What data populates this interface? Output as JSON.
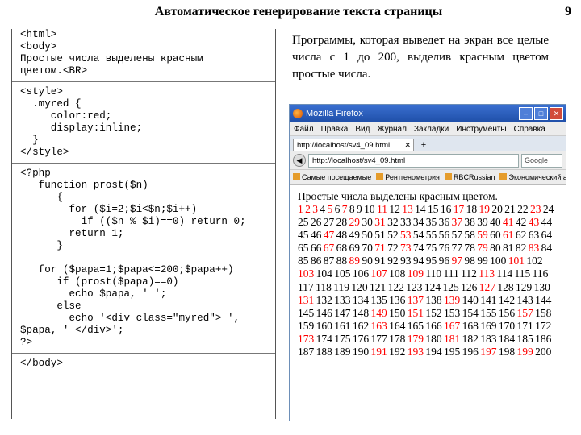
{
  "page": {
    "title": "Автоматическое генерирование текста страницы",
    "number": "9"
  },
  "code": {
    "html_block": [
      "<html>",
      "<body>",
      "Простые числа выделены красным",
      "цветом.<BR>"
    ],
    "style_block": [
      "<style>",
      "  .myred {",
      "     color:red;",
      "     display:inline;",
      "  }",
      "</style>"
    ],
    "php_block": [
      "<?php",
      "   function prost($n)",
      "      {",
      "        for ($i=2;$i<$n;$i++)",
      "          if (($n % $i)==0) return 0;",
      "        return 1;",
      "      }",
      "",
      "   for ($papa=1;$papa<=200;$papa++)",
      "      if (prost($papa)==0)",
      "        echo $papa, ' ';",
      "      else",
      "        echo '<div class=\"myred\"> ',",
      "$papa, ' </div>';",
      "?>"
    ],
    "end_block": [
      "</body>"
    ]
  },
  "task_text": "Программы, которая выведет на экран все целые числа с 1 до 200, выделив красным цветом простые числа.",
  "browser": {
    "title": "Mozilla Firefox",
    "menu": [
      "Файл",
      "Правка",
      "Вид",
      "Журнал",
      "Закладки",
      "Инструменты",
      "Справка"
    ],
    "tab_label": "http://localhost/sv4_09.html",
    "url": "http://localhost/sv4_09.html",
    "search_placeholder": "Google",
    "bookmarks": [
      "Самые посещаемые",
      "Рентгенометрия",
      "RBCRussian",
      "Экономический анализ"
    ],
    "heading": "Простые числа выделены красным цветом.",
    "range_start": 1,
    "range_end": 200,
    "red_color": "#ff0000"
  }
}
